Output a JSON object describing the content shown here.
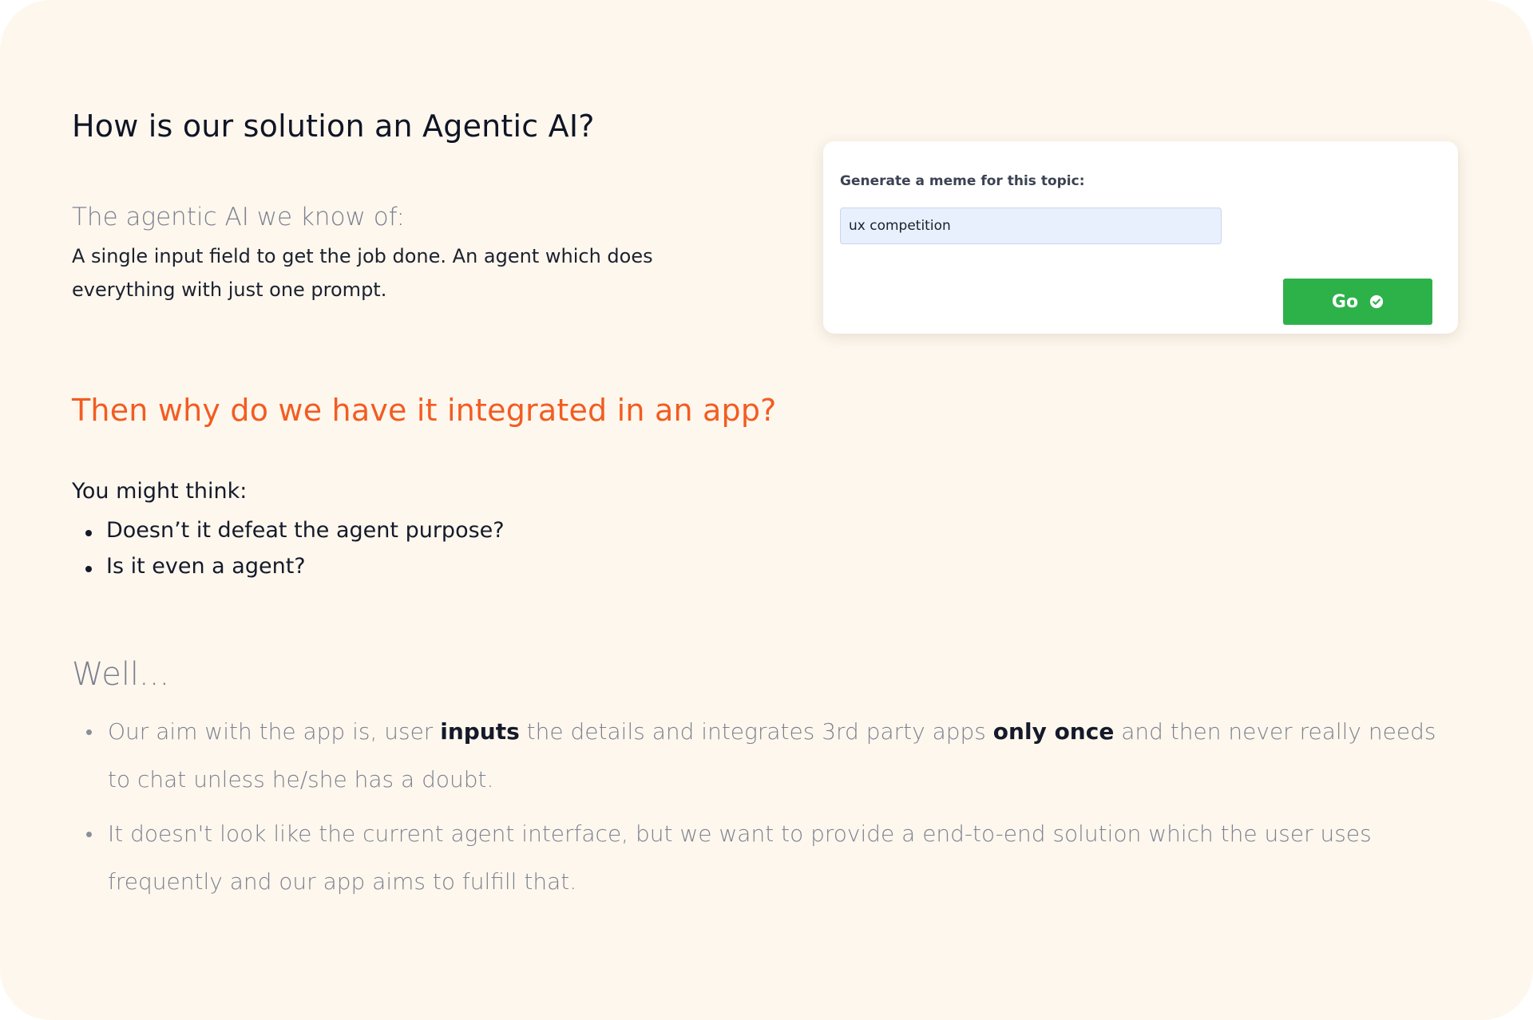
{
  "section1": {
    "heading": "How is our solution an Agentic AI?",
    "subheading": "The agentic AI we know of:",
    "paragraph": "A single input field to get the job done. An agent which does everything with just one prompt."
  },
  "widget": {
    "label": "Generate a meme for this topic:",
    "input_value": "ux competition",
    "button_label": "Go",
    "button_icon": "check-circle-icon",
    "button_color": "#2db24a",
    "input_bg": "#e8f0fe"
  },
  "section2": {
    "heading": "Then why do we have it integrated in an app?",
    "accent_color": "#f25c22",
    "intro": "You might think:",
    "bullets": [
      "Doesn’t it defeat the agent purpose?",
      "Is it even a agent?"
    ]
  },
  "section3": {
    "heading": "Well...",
    "bullet1": {
      "part1": "Our aim with the app is, user ",
      "bold1": "inputs",
      "part2": " the details and integrates 3rd party apps ",
      "bold2": "only once",
      "part3": " and then never really needs to chat unless he/she has a doubt."
    },
    "bullet2": "It doesn't look like the current agent interface, but we want to provide a end-to-end solution which the user uses frequently and our app aims to fulfill that."
  },
  "colors": {
    "background": "#fef7ed",
    "text": "#141a2b",
    "muted": "#7c8190"
  }
}
